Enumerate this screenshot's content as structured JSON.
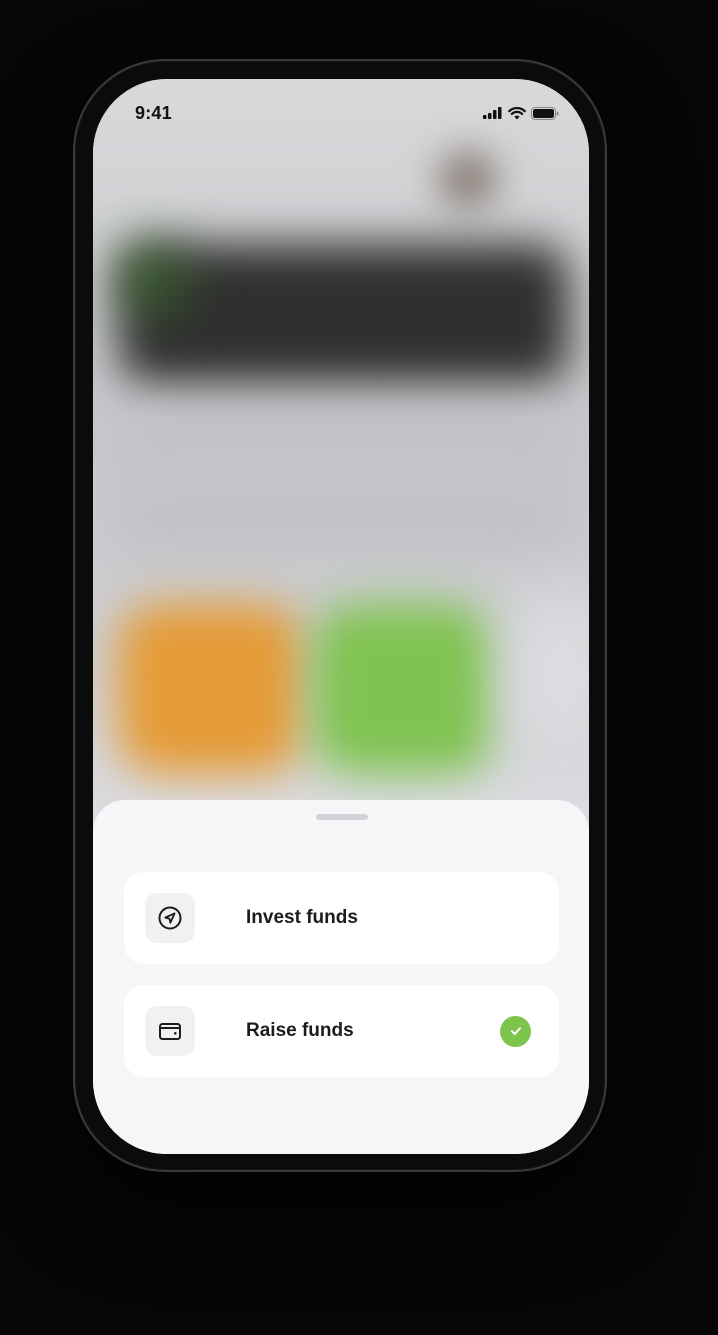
{
  "status_bar": {
    "time": "9:41",
    "icons": [
      "signal-icon",
      "wifi-icon",
      "battery-icon"
    ]
  },
  "sheet": {
    "options": [
      {
        "label": "Invest funds",
        "icon": "send-icon",
        "selected": false
      },
      {
        "label": "Raise funds",
        "icon": "wallet-icon",
        "selected": true
      }
    ]
  },
  "colors": {
    "accent_check": "#7cc44c",
    "sheet_bg": "#f5f6f8",
    "card_bg": "#ffffff"
  }
}
